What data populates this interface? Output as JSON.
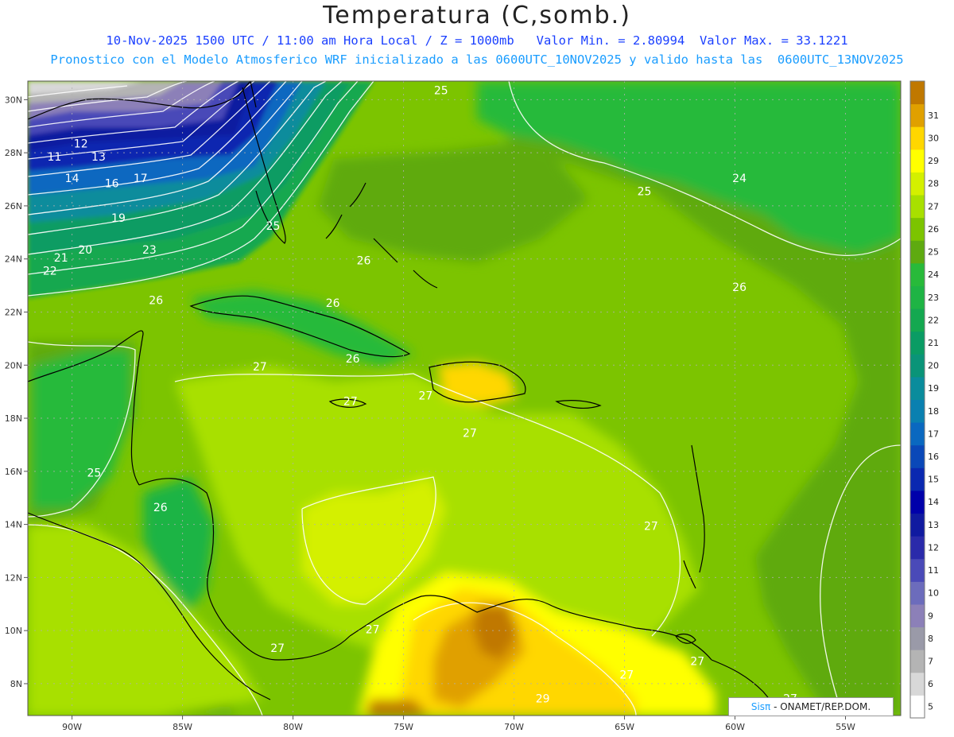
{
  "title": "Temperatura (C,somb.)",
  "subtitle_line1": "10-Nov-2025 1500 UTC / 11:00 am Hora Local / Z = 1000mb   Valor Min. = 2.80994  Valor Max. = 33.1221",
  "subtitle_line2": "Pronostico con el Modelo Atmosferico WRF inicializado a las 0600UTC_10NOV2025 y valido hasta las  0600UTC_13NOV2025",
  "credit": {
    "brand": "Sisπ",
    "rest": " - ONAMET/REP.DOM."
  },
  "chart_data": {
    "type": "heatmap",
    "xlim": [
      -92,
      -52.5
    ],
    "ylim": [
      6.8,
      30.7
    ],
    "lon_ticks": [
      {
        "v": -90,
        "t": "90W"
      },
      {
        "v": -85,
        "t": "85W"
      },
      {
        "v": -80,
        "t": "80W"
      },
      {
        "v": -75,
        "t": "75W"
      },
      {
        "v": -70,
        "t": "70W"
      },
      {
        "v": -65,
        "t": "65W"
      },
      {
        "v": -60,
        "t": "60W"
      },
      {
        "v": -55,
        "t": "55W"
      }
    ],
    "lat_ticks": [
      {
        "v": 30,
        "t": "30N"
      },
      {
        "v": 28,
        "t": "28N"
      },
      {
        "v": 26,
        "t": "26N"
      },
      {
        "v": 24,
        "t": "24N"
      },
      {
        "v": 22,
        "t": "22N"
      },
      {
        "v": 20,
        "t": "20N"
      },
      {
        "v": 18,
        "t": "18N"
      },
      {
        "v": 16,
        "t": "16N"
      },
      {
        "v": 14,
        "t": "14N"
      },
      {
        "v": 12,
        "t": "12N"
      },
      {
        "v": 10,
        "t": "10N"
      },
      {
        "v": 8,
        "t": "8N"
      }
    ],
    "colorbar": {
      "levels": [
        5,
        6,
        7,
        8,
        9,
        10,
        11,
        12,
        13,
        14,
        15,
        16,
        17,
        18,
        19,
        20,
        21,
        22,
        23,
        24,
        25,
        26,
        27,
        28,
        29,
        30,
        31
      ],
      "colors": [
        "#ffffff",
        "#d8d8d8",
        "#b4b4b4",
        "#9a9aa8",
        "#8c80b8",
        "#6c6cbc",
        "#4a4ab8",
        "#2a2aaa",
        "#101aa0",
        "#0000aa",
        "#0a28b0",
        "#0a48b8",
        "#0a68c0",
        "#0a80b0",
        "#0a8c9c",
        "#0a9478",
        "#0a9c64",
        "#14a850",
        "#1eb444",
        "#28ba3a",
        "#5eaa10",
        "#7cc400",
        "#a8e000",
        "#d4f000",
        "#ffff00",
        "#ffd700",
        "#e0a000",
        "#c07800"
      ]
    },
    "contour_labels": [
      {
        "v": "25",
        "lon": -73.3,
        "lat": 30.2
      },
      {
        "v": "25",
        "lon": -64.1,
        "lat": 26.4
      },
      {
        "v": "24",
        "lon": -59.8,
        "lat": 26.9
      },
      {
        "v": "12",
        "lon": -89.6,
        "lat": 28.2
      },
      {
        "v": "13",
        "lon": -88.8,
        "lat": 27.7
      },
      {
        "v": "11",
        "lon": -90.8,
        "lat": 27.7
      },
      {
        "v": "14",
        "lon": -90.0,
        "lat": 26.9
      },
      {
        "v": "16",
        "lon": -88.2,
        "lat": 26.7
      },
      {
        "v": "17",
        "lon": -86.9,
        "lat": 26.9
      },
      {
        "v": "19",
        "lon": -87.9,
        "lat": 25.4
      },
      {
        "v": "20",
        "lon": -89.4,
        "lat": 24.2
      },
      {
        "v": "21",
        "lon": -90.5,
        "lat": 23.9
      },
      {
        "v": "22",
        "lon": -91.0,
        "lat": 23.4
      },
      {
        "v": "23",
        "lon": -86.5,
        "lat": 24.2
      },
      {
        "v": "25",
        "lon": -80.9,
        "lat": 25.1
      },
      {
        "v": "26",
        "lon": -76.8,
        "lat": 23.8
      },
      {
        "v": "26",
        "lon": -86.2,
        "lat": 22.3
      },
      {
        "v": "26",
        "lon": -78.2,
        "lat": 22.2
      },
      {
        "v": "26",
        "lon": -59.8,
        "lat": 22.8
      },
      {
        "v": "26",
        "lon": -77.3,
        "lat": 20.1
      },
      {
        "v": "27",
        "lon": -81.5,
        "lat": 19.8
      },
      {
        "v": "27",
        "lon": -77.4,
        "lat": 18.5
      },
      {
        "v": "27",
        "lon": -74.0,
        "lat": 18.7
      },
      {
        "v": "27",
        "lon": -72.0,
        "lat": 17.3
      },
      {
        "v": "25",
        "lon": -89.0,
        "lat": 15.8
      },
      {
        "v": "26",
        "lon": -86.0,
        "lat": 14.5
      },
      {
        "v": "27",
        "lon": -63.8,
        "lat": 13.8
      },
      {
        "v": "27",
        "lon": -80.7,
        "lat": 9.2
      },
      {
        "v": "27",
        "lon": -76.4,
        "lat": 9.9
      },
      {
        "v": "27",
        "lon": -64.9,
        "lat": 8.2
      },
      {
        "v": "27",
        "lon": -61.7,
        "lat": 8.7
      },
      {
        "v": "27",
        "lon": -57.5,
        "lat": 7.3
      },
      {
        "v": "29",
        "lon": -68.7,
        "lat": 7.3
      }
    ]
  }
}
